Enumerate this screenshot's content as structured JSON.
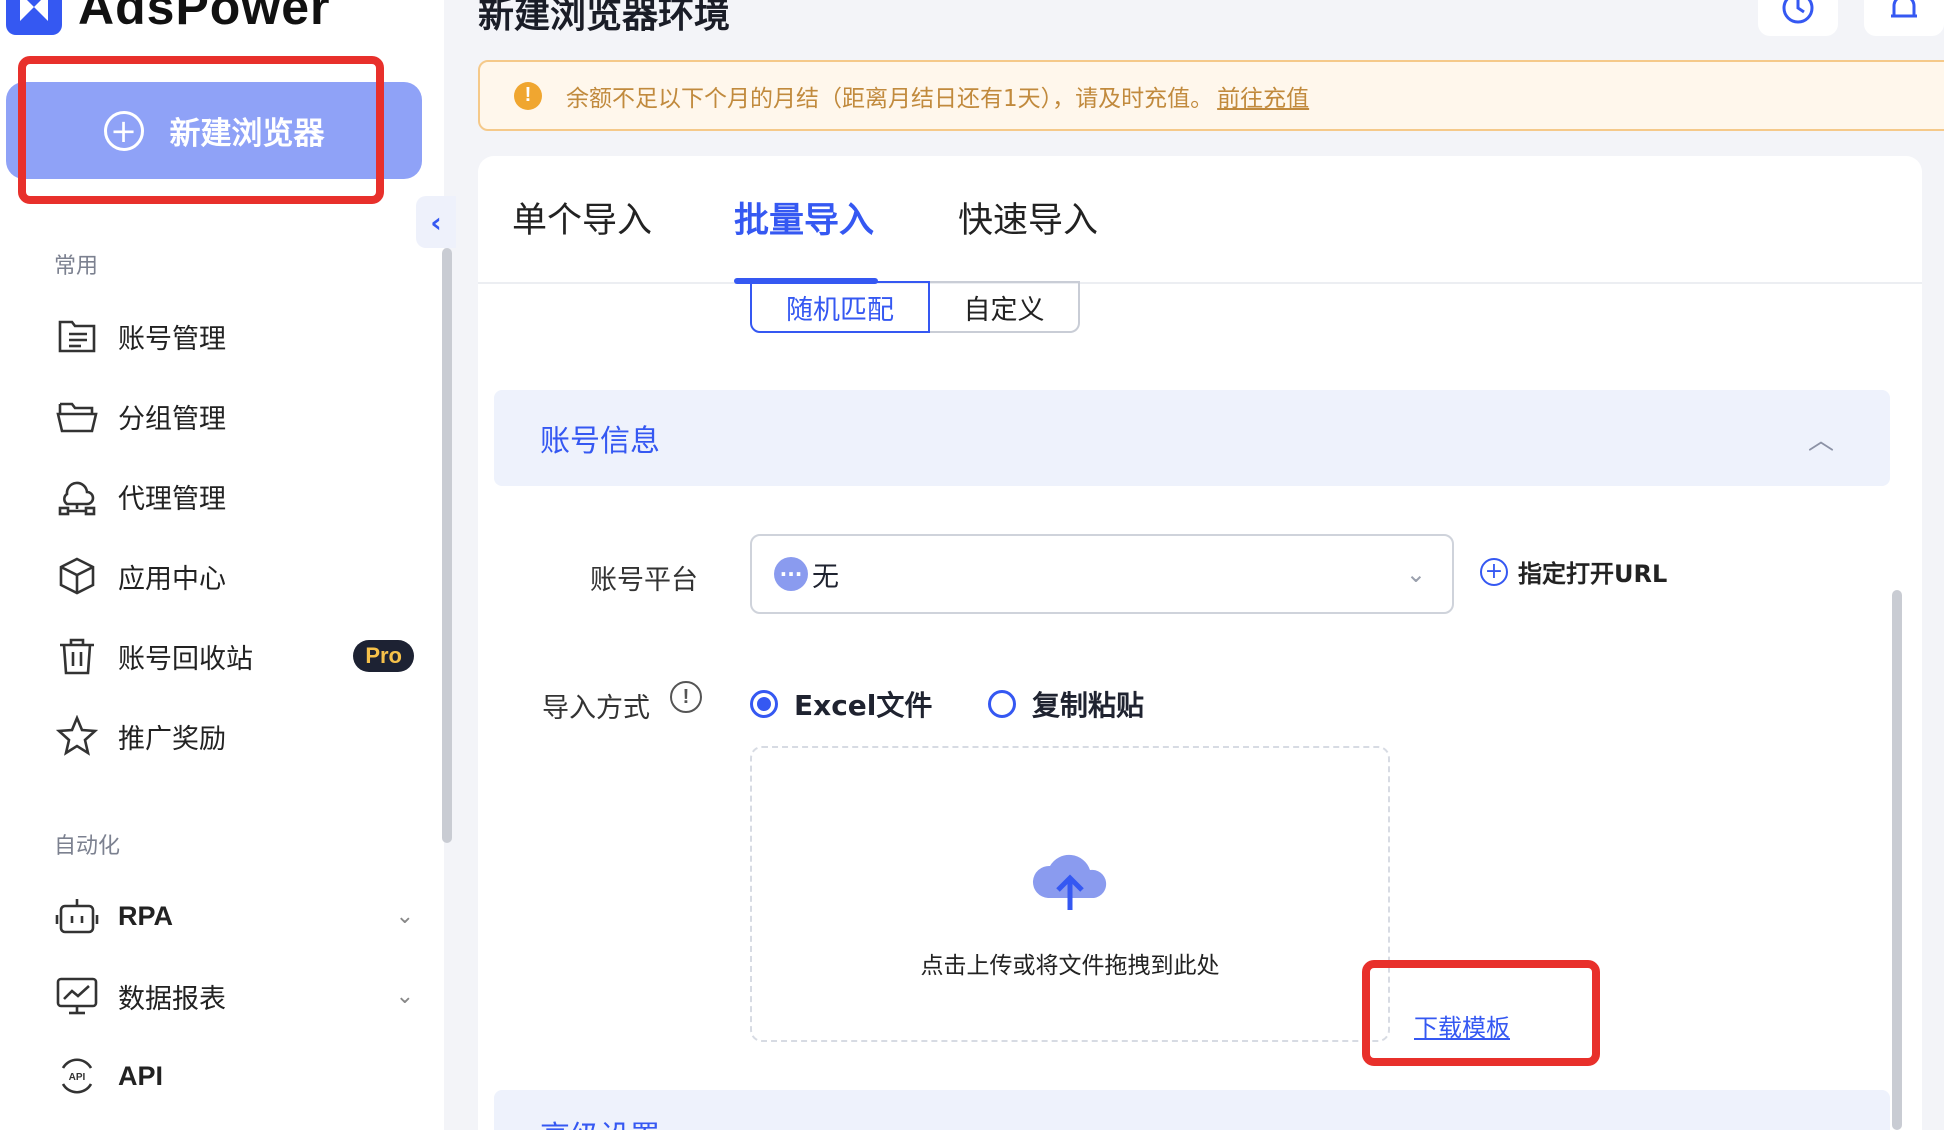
{
  "app": {
    "logo_text": "AdsPower"
  },
  "sidebar": {
    "new_browser_label": "新建浏览器",
    "section_common": "常用",
    "items": [
      {
        "label": "账号管理",
        "icon": "account-list-icon"
      },
      {
        "label": "分组管理",
        "icon": "folder-icon"
      },
      {
        "label": "代理管理",
        "icon": "proxy-network-icon"
      },
      {
        "label": "应用中心",
        "icon": "cube-icon"
      },
      {
        "label": "账号回收站",
        "icon": "trash-icon",
        "badge": "Pro"
      },
      {
        "label": "推广奖励",
        "icon": "star-icon"
      }
    ],
    "section_auto": "自动化",
    "auto_items": [
      {
        "label": "RPA",
        "icon": "robot-icon"
      },
      {
        "label": "数据报表",
        "icon": "chart-monitor-icon"
      },
      {
        "label": "API",
        "icon": "api-icon"
      }
    ]
  },
  "header": {
    "title": "新建浏览器环境"
  },
  "notice": {
    "text": "余额不足以下个月的月结（距离月结日还有1天），请及时充值。",
    "link": "前往充值"
  },
  "tabs": [
    "单个导入",
    "批量导入",
    "快速导入"
  ],
  "active_tab": "批量导入",
  "segment": {
    "selected": "随机匹配",
    "other": "自定义"
  },
  "account_section": {
    "title": "账号信息"
  },
  "form": {
    "platform_label": "账号平台",
    "platform_value": "无",
    "specify_url_label": "指定打开URL",
    "import_method_label": "导入方式",
    "radio_excel": "Excel文件",
    "radio_paste": "复制粘贴",
    "upload_text": "点击上传或将文件拖拽到此处",
    "download_template": "下载模板"
  },
  "advanced_section": {
    "title": "高级设置"
  },
  "colors": {
    "accent": "#3558f2",
    "button": "#8fa2f7",
    "highlight": "#e8302b",
    "notice": "#c18a3d"
  }
}
